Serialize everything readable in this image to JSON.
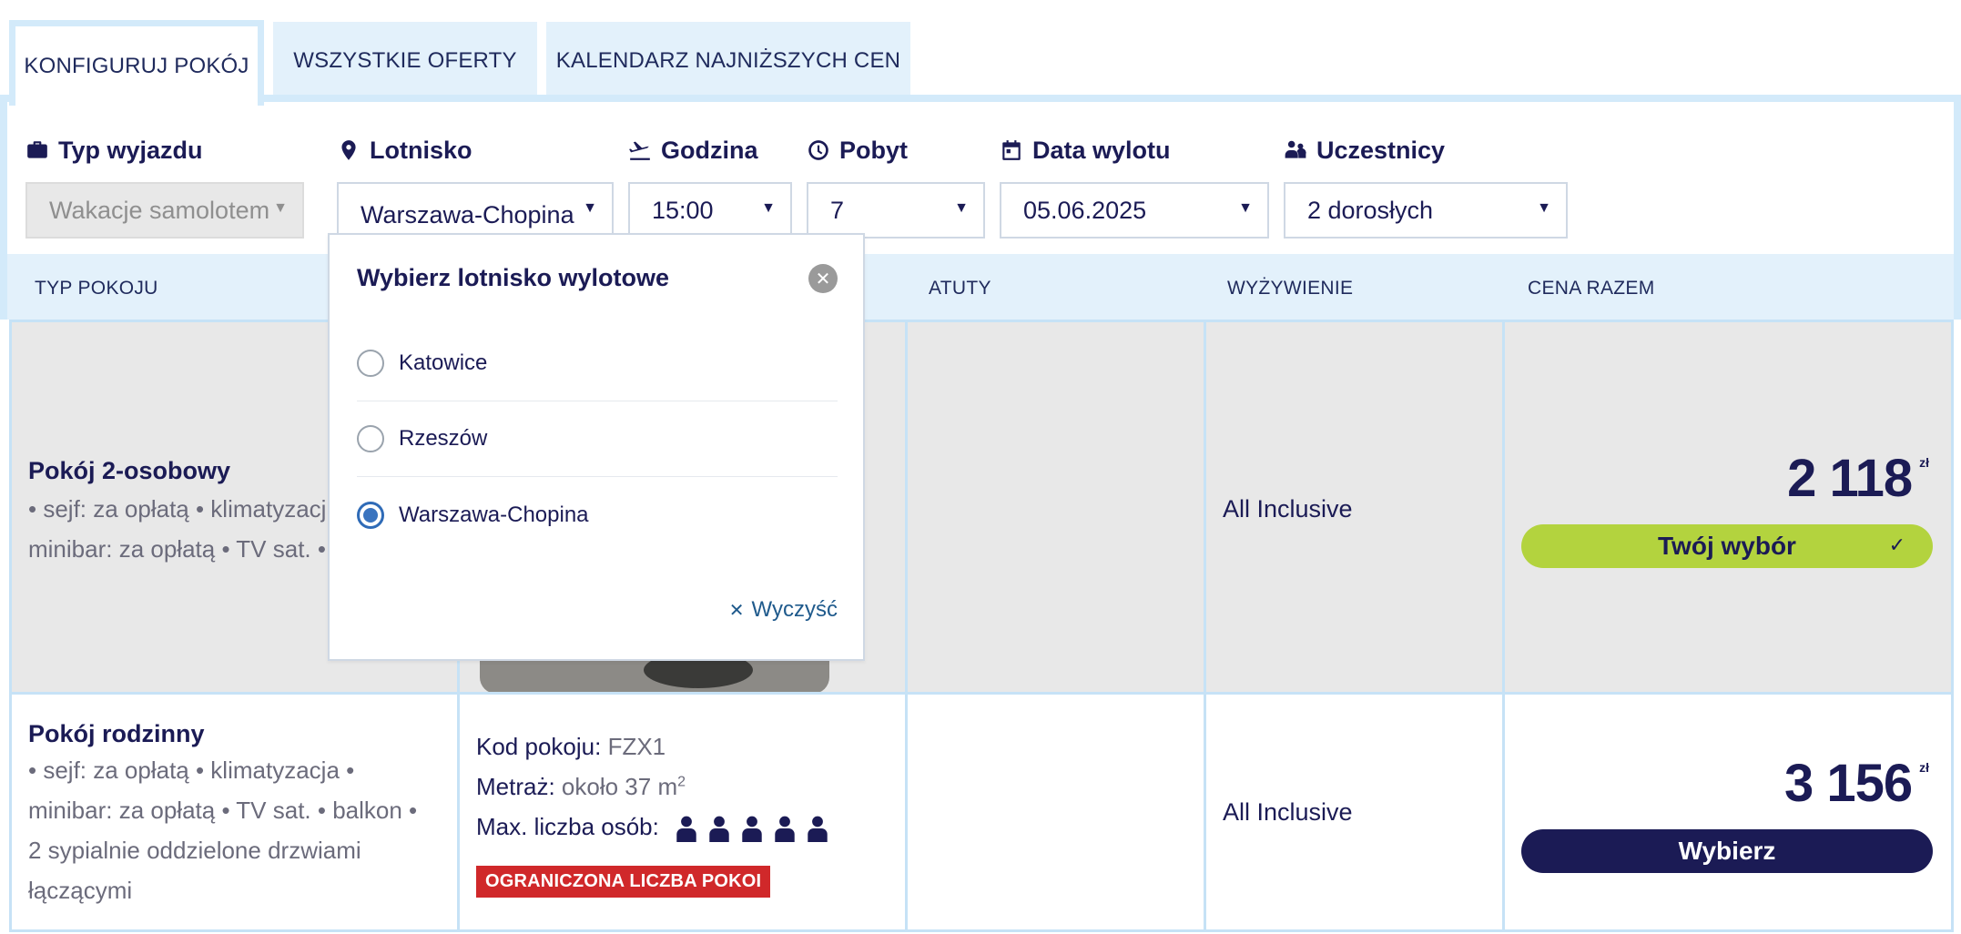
{
  "tabs": [
    {
      "label": "KONFIGURUJ POKÓJ",
      "active": true
    },
    {
      "label": "WSZYSTKIE OFERTY",
      "active": false
    },
    {
      "label": "KALENDARZ NAJNIŻSZYCH CEN",
      "active": false
    }
  ],
  "filters": {
    "trip_type": {
      "label": "Typ wyjazdu",
      "value": "Wakacje samolotem",
      "icon": "suitcase-icon"
    },
    "airport": {
      "label": "Lotnisko",
      "value": "Warszawa-Chopina",
      "icon": "map-pin-icon"
    },
    "time": {
      "label": "Godzina",
      "value": "15:00",
      "icon": "plane-takeoff-icon"
    },
    "stay": {
      "label": "Pobyt",
      "value": "7",
      "icon": "clock-icon"
    },
    "departure_date": {
      "label": "Data wylotu",
      "value": "05.06.2025",
      "icon": "calendar-icon"
    },
    "participants": {
      "label": "Uczestnicy",
      "value": "2 dorosłych",
      "icon": "people-icon"
    }
  },
  "table_headers": {
    "room_type": "TYP POKOJU",
    "perks": "ATUTY",
    "board": "WYŻYWIENIE",
    "total_price": "CENA RAZEM"
  },
  "rooms": [
    {
      "title": "Pokój 2-osobowy",
      "features_line1": "• sejf: za opłatą • klimatyzacj",
      "features_line2": "minibar: za opłatą • TV sat. •",
      "board": "All Inclusive",
      "price": "2 118",
      "currency": "zł",
      "button": "Twój wybór",
      "selected": true
    },
    {
      "title": "Pokój rodzinny",
      "features_line1": "• sejf: za opłatą • klimatyzacja •",
      "features_line2": "minibar: za opłatą • TV sat. • balkon •",
      "features_line3": "2 sypialnie oddzielone drzwiami",
      "features_line4": "łączącymi",
      "code_label": "Kod pokoju:",
      "code_value": "FZX1",
      "area_label": "Metraż:",
      "area_value": "około 37 m",
      "area_unit_sup": "2",
      "max_persons_label": "Max. liczba osób:",
      "max_persons": 5,
      "badge": "OGRANICZONA LICZBA POKOI",
      "board": "All Inclusive",
      "price": "3 156",
      "currency": "zł",
      "button": "Wybierz",
      "selected": false
    }
  ],
  "airport_popup": {
    "title": "Wybierz lotnisko wylotowe",
    "options": [
      {
        "label": "Katowice",
        "checked": false
      },
      {
        "label": "Rzeszów",
        "checked": false
      },
      {
        "label": "Warszawa-Chopina",
        "checked": true
      }
    ],
    "clear_label": "Wyczyść"
  },
  "colors": {
    "navy": "#1b1b55",
    "light_blue": "#e3f1fb",
    "selected_green": "#b3d33e",
    "badge_red": "#d0282a",
    "radio_blue": "#3a74bf"
  }
}
